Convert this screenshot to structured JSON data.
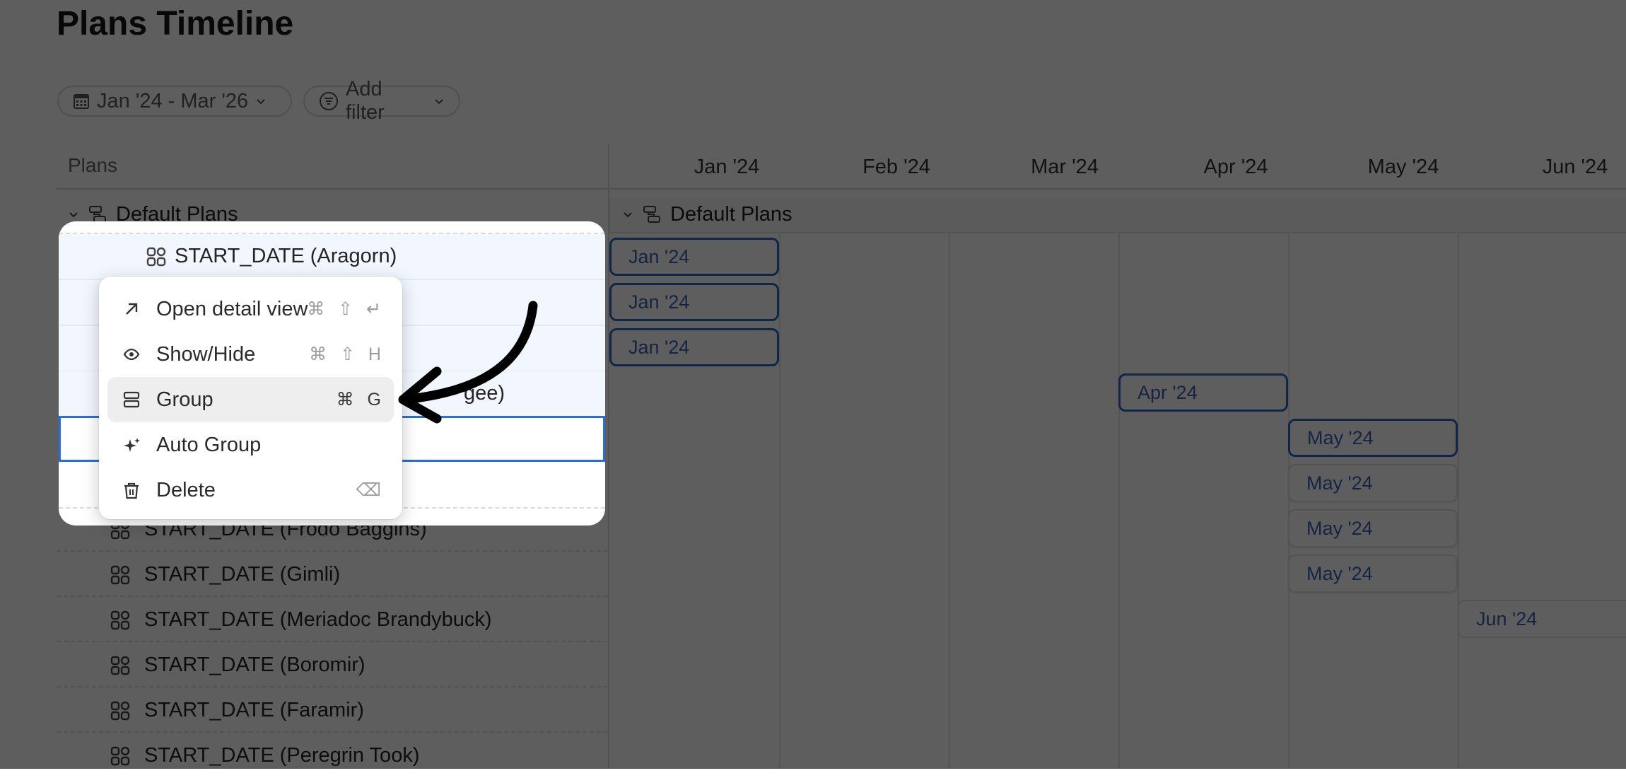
{
  "page": {
    "title": "Plans Timeline"
  },
  "filters": {
    "date_range": "Jan '24 - Mar '26",
    "add_filter": "Add filter"
  },
  "table": {
    "plans_header": "Plans",
    "group_label": "Default Plans"
  },
  "timeline": {
    "months": [
      "Jan '24",
      "Feb '24",
      "Mar '24",
      "Apr '24",
      "May '24",
      "Jun '24"
    ],
    "group_label": "Default Plans"
  },
  "rows": [
    {
      "label": "START_DATE (Aragorn)",
      "bar": "Jan '24"
    },
    {
      "label": "",
      "bar": "Jan '24"
    },
    {
      "label": "",
      "bar": "Jan '24"
    },
    {
      "label": "gee)",
      "bar": "Apr '24"
    },
    {
      "label": "",
      "bar": "May '24"
    },
    {
      "label": "",
      "bar": "May '24"
    },
    {
      "label": "START_DATE (Frodo Baggins)",
      "bar": "May '24"
    },
    {
      "label": "START_DATE (Gimli)",
      "bar": "May '24"
    },
    {
      "label": "START_DATE (Meriadoc Brandybuck)",
      "bar": "Jun '24"
    },
    {
      "label": "START_DATE (Boromir)",
      "bar": ""
    },
    {
      "label": "START_DATE (Faramir)",
      "bar": ""
    },
    {
      "label": "START_DATE (Peregrin Took)",
      "bar": ""
    }
  ],
  "context_menu": {
    "items": [
      {
        "label": "Open detail view",
        "shortcut": "⌘ ⇧ ↵",
        "icon": "arrow-up-right-icon"
      },
      {
        "label": "Show/Hide",
        "shortcut": "⌘ ⇧ H",
        "icon": "eye-icon"
      },
      {
        "label": "Group",
        "shortcut": "⌘ G",
        "icon": "group-icon"
      },
      {
        "label": "Auto Group",
        "shortcut": "",
        "icon": "sparkle-icon"
      },
      {
        "label": "Delete",
        "shortcut": "⌫",
        "icon": "trash-icon"
      }
    ],
    "active_item": "Group"
  },
  "colors": {
    "accent": "#2a67c6",
    "bar_text": "#3a63b5"
  }
}
